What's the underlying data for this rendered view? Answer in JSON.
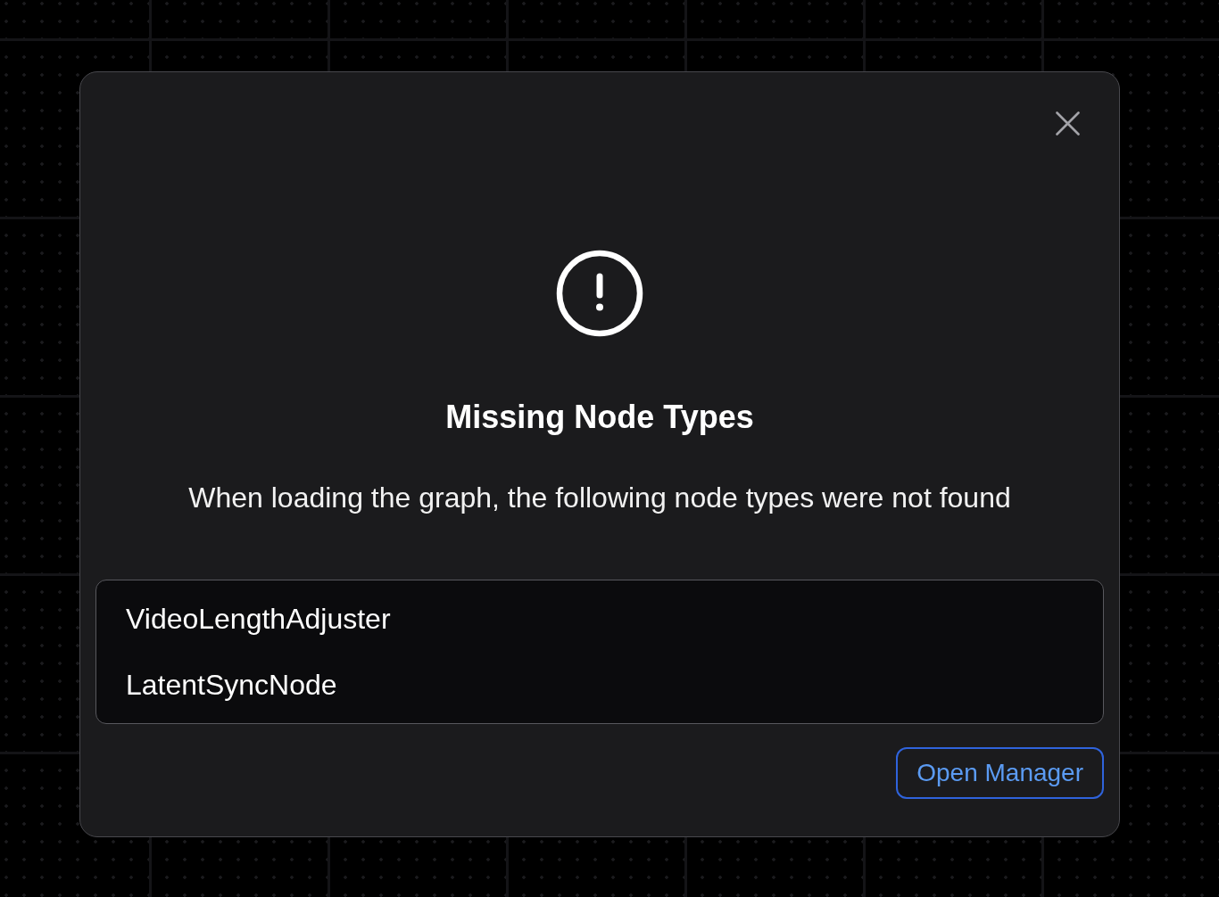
{
  "dialog": {
    "title": "Missing Node Types",
    "message": "When loading the graph, the following node types were not found",
    "missing_node_types": [
      "VideoLengthAdjuster",
      "LatentSyncNode"
    ],
    "action_button": {
      "label": "Open Manager"
    }
  }
}
